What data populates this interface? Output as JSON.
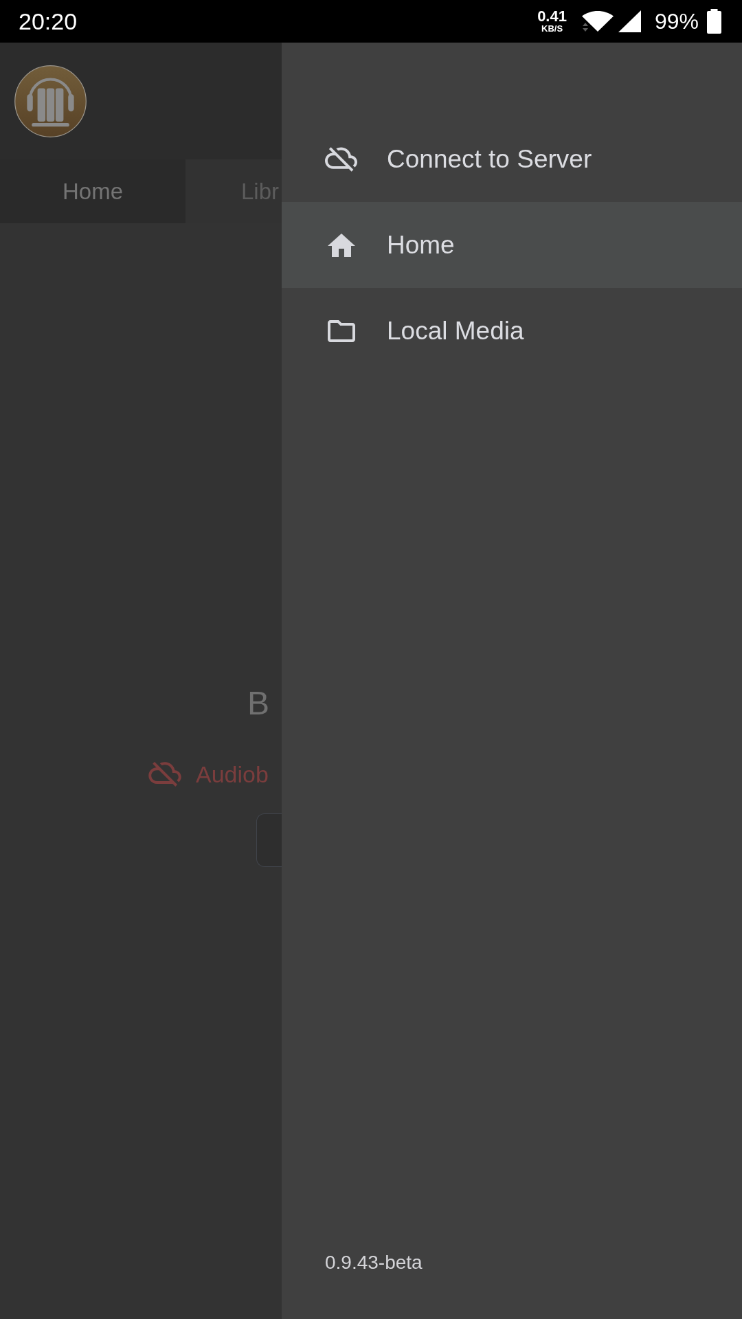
{
  "status_bar": {
    "time": "20:20",
    "net_speed": "0.41",
    "net_unit": "KB/S",
    "battery": "99%"
  },
  "tabs": [
    {
      "label": "Home",
      "selected": true
    },
    {
      "label": "Libr",
      "selected": false
    }
  ],
  "content": {
    "title": "B",
    "status": "Audiob"
  },
  "drawer": {
    "items": [
      {
        "kind": "server",
        "label": "Connect to Server",
        "selected": false
      },
      {
        "kind": "home",
        "label": "Home",
        "selected": true
      },
      {
        "kind": "media",
        "label": "Local Media",
        "selected": false
      }
    ],
    "version": "0.9.43-beta"
  }
}
